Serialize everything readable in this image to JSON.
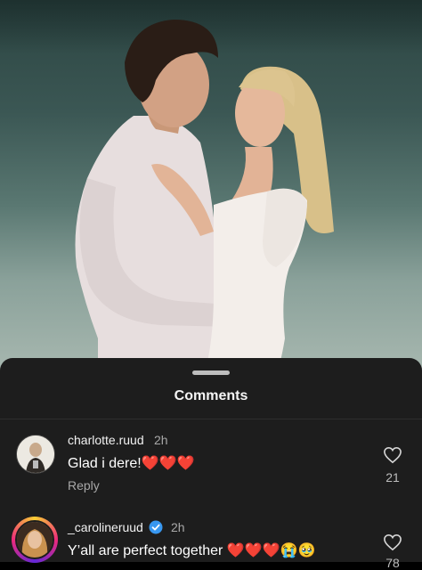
{
  "sheet": {
    "title": "Comments"
  },
  "comments": [
    {
      "username": "charlotte.ruud",
      "time": "2h",
      "text": "Glad i dere!❤️❤️❤️",
      "reply_label": "Reply",
      "likes": "21"
    },
    {
      "username": "_carolineruud",
      "verified": true,
      "time": "2h",
      "text": "Y’all are perfect together ❤️❤️❤️😭🥹",
      "likes": "78"
    }
  ],
  "colors": {
    "sheet_bg": "#1d1d1d",
    "verified_badge": "#3897f0"
  }
}
